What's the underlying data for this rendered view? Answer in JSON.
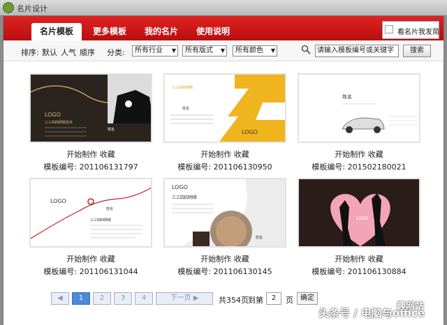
{
  "window": {
    "title": "名片设计"
  },
  "tabs": [
    {
      "label": "名片模板",
      "active": true
    },
    {
      "label": "更多模板",
      "active": false
    },
    {
      "label": "我的名片",
      "active": false
    },
    {
      "label": "使用说明",
      "active": false
    }
  ],
  "ad": {
    "label": "看名片我发简"
  },
  "filters": {
    "sort_label": "排序:",
    "sort_options": [
      "默认",
      "人气",
      "顺序"
    ],
    "category_label": "分类:",
    "industry": "所有行业",
    "layout": "所有版式",
    "color": "所有颜色"
  },
  "search": {
    "placeholder": "请输入模板编号或关键字",
    "button": "搜索"
  },
  "templates": [
    {
      "action_start": "开始制作",
      "action_save": "收藏",
      "code_label": "模板编号:",
      "code": "201106131797",
      "logo": "LOGO",
      "name": "姓名",
      "company": "三三四四网络技术"
    },
    {
      "action_start": "开始制作",
      "action_save": "收藏",
      "code_label": "模板编号:",
      "code": "201106130950",
      "logo": "LOGO",
      "name": "姓名",
      "company": "三三四四网络"
    },
    {
      "action_start": "开始制作",
      "action_save": "收藏",
      "code_label": "模板编号:",
      "code": "201502180021",
      "logo": "",
      "name": "姓名",
      "company": ""
    },
    {
      "action_start": "开始制作",
      "action_save": "收藏",
      "code_label": "模板编号:",
      "code": "201106131044",
      "logo": "LOGO",
      "name": "姓名",
      "company": "三三四四网络"
    },
    {
      "action_start": "开始制作",
      "action_save": "收藏",
      "code_label": "模板编号:",
      "code": "201106130145",
      "logo": "LOGO",
      "name": "姓名",
      "company": "三三四四网络"
    },
    {
      "action_start": "开始制作",
      "action_save": "收藏",
      "code_label": "模板编号:",
      "code": "201106130884",
      "logo": "LOGO",
      "name": "",
      "company": ""
    }
  ],
  "pager": {
    "prev": "◀",
    "pages": [
      "1",
      "2",
      "3",
      "4"
    ],
    "current": "1",
    "next": "下一页 ▶",
    "total_text": "共354页",
    "goto_label": "到第",
    "goto_value": "2",
    "page_unit": "页",
    "confirm": "确定"
  },
  "watermark": {
    "text": "头条号 / 电脑与office",
    "logo": "趣网站"
  },
  "colors": {
    "accent_red": "#d11a1a",
    "page_current": "#4e89d8"
  }
}
